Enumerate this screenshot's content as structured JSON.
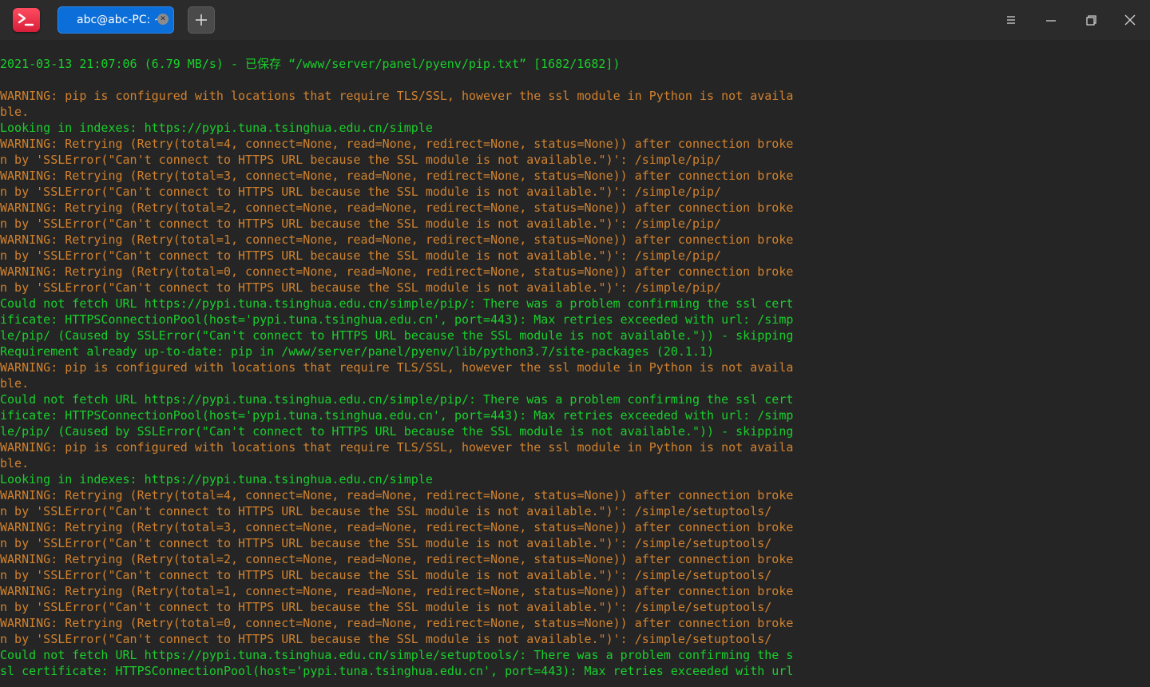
{
  "titlebar": {
    "app_icon": "terminal-app-icon",
    "tab_title": "abc@abc-PC: ~",
    "close_tab_icon": "close-icon",
    "new_tab_icon": "plus-icon",
    "menu_icon": "hamburger-menu-icon",
    "minimize_icon": "minimize-icon",
    "restore_icon": "restore-icon",
    "close_icon": "close-icon"
  },
  "colors": {
    "background": "#252525",
    "titlebar": "#2b2b2b",
    "tab_active": "#0b6ed9",
    "text_green": "#19cf2c",
    "text_orange": "#d1822f"
  },
  "terminal": {
    "lines": [
      {
        "color": "green",
        "text": "2021-03-13 21:07:06 (6.79 MB/s) - 已保存 “/www/server/panel/pyenv/pip.txt” [1682/1682])"
      },
      {
        "color": "blank",
        "text": " "
      },
      {
        "color": "orange",
        "text": "WARNING: pip is configured with locations that require TLS/SSL, however the ssl module in Python is not availa"
      },
      {
        "color": "orange",
        "text": "ble."
      },
      {
        "color": "green",
        "text": "Looking in indexes: https://pypi.tuna.tsinghua.edu.cn/simple"
      },
      {
        "color": "orange",
        "text": "WARNING: Retrying (Retry(total=4, connect=None, read=None, redirect=None, status=None)) after connection broke"
      },
      {
        "color": "orange",
        "text": "n by 'SSLError(\"Can't connect to HTTPS URL because the SSL module is not available.\")': /simple/pip/"
      },
      {
        "color": "orange",
        "text": "WARNING: Retrying (Retry(total=3, connect=None, read=None, redirect=None, status=None)) after connection broke"
      },
      {
        "color": "orange",
        "text": "n by 'SSLError(\"Can't connect to HTTPS URL because the SSL module is not available.\")': /simple/pip/"
      },
      {
        "color": "orange",
        "text": "WARNING: Retrying (Retry(total=2, connect=None, read=None, redirect=None, status=None)) after connection broke"
      },
      {
        "color": "orange",
        "text": "n by 'SSLError(\"Can't connect to HTTPS URL because the SSL module is not available.\")': /simple/pip/"
      },
      {
        "color": "orange",
        "text": "WARNING: Retrying (Retry(total=1, connect=None, read=None, redirect=None, status=None)) after connection broke"
      },
      {
        "color": "orange",
        "text": "n by 'SSLError(\"Can't connect to HTTPS URL because the SSL module is not available.\")': /simple/pip/"
      },
      {
        "color": "orange",
        "text": "WARNING: Retrying (Retry(total=0, connect=None, read=None, redirect=None, status=None)) after connection broke"
      },
      {
        "color": "orange",
        "text": "n by 'SSLError(\"Can't connect to HTTPS URL because the SSL module is not available.\")': /simple/pip/"
      },
      {
        "color": "green",
        "text": "Could not fetch URL https://pypi.tuna.tsinghua.edu.cn/simple/pip/: There was a problem confirming the ssl cert"
      },
      {
        "color": "green",
        "text": "ificate: HTTPSConnectionPool(host='pypi.tuna.tsinghua.edu.cn', port=443): Max retries exceeded with url: /simp"
      },
      {
        "color": "green",
        "text": "le/pip/ (Caused by SSLError(\"Can't connect to HTTPS URL because the SSL module is not available.\")) - skipping"
      },
      {
        "color": "green",
        "text": "Requirement already up-to-date: pip in /www/server/panel/pyenv/lib/python3.7/site-packages (20.1.1)"
      },
      {
        "color": "orange",
        "text": "WARNING: pip is configured with locations that require TLS/SSL, however the ssl module in Python is not availa"
      },
      {
        "color": "orange",
        "text": "ble."
      },
      {
        "color": "green",
        "text": "Could not fetch URL https://pypi.tuna.tsinghua.edu.cn/simple/pip/: There was a problem confirming the ssl cert"
      },
      {
        "color": "green",
        "text": "ificate: HTTPSConnectionPool(host='pypi.tuna.tsinghua.edu.cn', port=443): Max retries exceeded with url: /simp"
      },
      {
        "color": "green",
        "text": "le/pip/ (Caused by SSLError(\"Can't connect to HTTPS URL because the SSL module is not available.\")) - skipping"
      },
      {
        "color": "orange",
        "text": "WARNING: pip is configured with locations that require TLS/SSL, however the ssl module in Python is not availa"
      },
      {
        "color": "orange",
        "text": "ble."
      },
      {
        "color": "green",
        "text": "Looking in indexes: https://pypi.tuna.tsinghua.edu.cn/simple"
      },
      {
        "color": "orange",
        "text": "WARNING: Retrying (Retry(total=4, connect=None, read=None, redirect=None, status=None)) after connection broke"
      },
      {
        "color": "orange",
        "text": "n by 'SSLError(\"Can't connect to HTTPS URL because the SSL module is not available.\")': /simple/setuptools/"
      },
      {
        "color": "orange",
        "text": "WARNING: Retrying (Retry(total=3, connect=None, read=None, redirect=None, status=None)) after connection broke"
      },
      {
        "color": "orange",
        "text": "n by 'SSLError(\"Can't connect to HTTPS URL because the SSL module is not available.\")': /simple/setuptools/"
      },
      {
        "color": "orange",
        "text": "WARNING: Retrying (Retry(total=2, connect=None, read=None, redirect=None, status=None)) after connection broke"
      },
      {
        "color": "orange",
        "text": "n by 'SSLError(\"Can't connect to HTTPS URL because the SSL module is not available.\")': /simple/setuptools/"
      },
      {
        "color": "orange",
        "text": "WARNING: Retrying (Retry(total=1, connect=None, read=None, redirect=None, status=None)) after connection broke"
      },
      {
        "color": "orange",
        "text": "n by 'SSLError(\"Can't connect to HTTPS URL because the SSL module is not available.\")': /simple/setuptools/"
      },
      {
        "color": "orange",
        "text": "WARNING: Retrying (Retry(total=0, connect=None, read=None, redirect=None, status=None)) after connection broke"
      },
      {
        "color": "orange",
        "text": "n by 'SSLError(\"Can't connect to HTTPS URL because the SSL module is not available.\")': /simple/setuptools/"
      },
      {
        "color": "green",
        "text": "Could not fetch URL https://pypi.tuna.tsinghua.edu.cn/simple/setuptools/: There was a problem confirming the s"
      },
      {
        "color": "green",
        "text": "sl certificate: HTTPSConnectionPool(host='pypi.tuna.tsinghua.edu.cn', port=443): Max retries exceeded with url"
      }
    ]
  }
}
